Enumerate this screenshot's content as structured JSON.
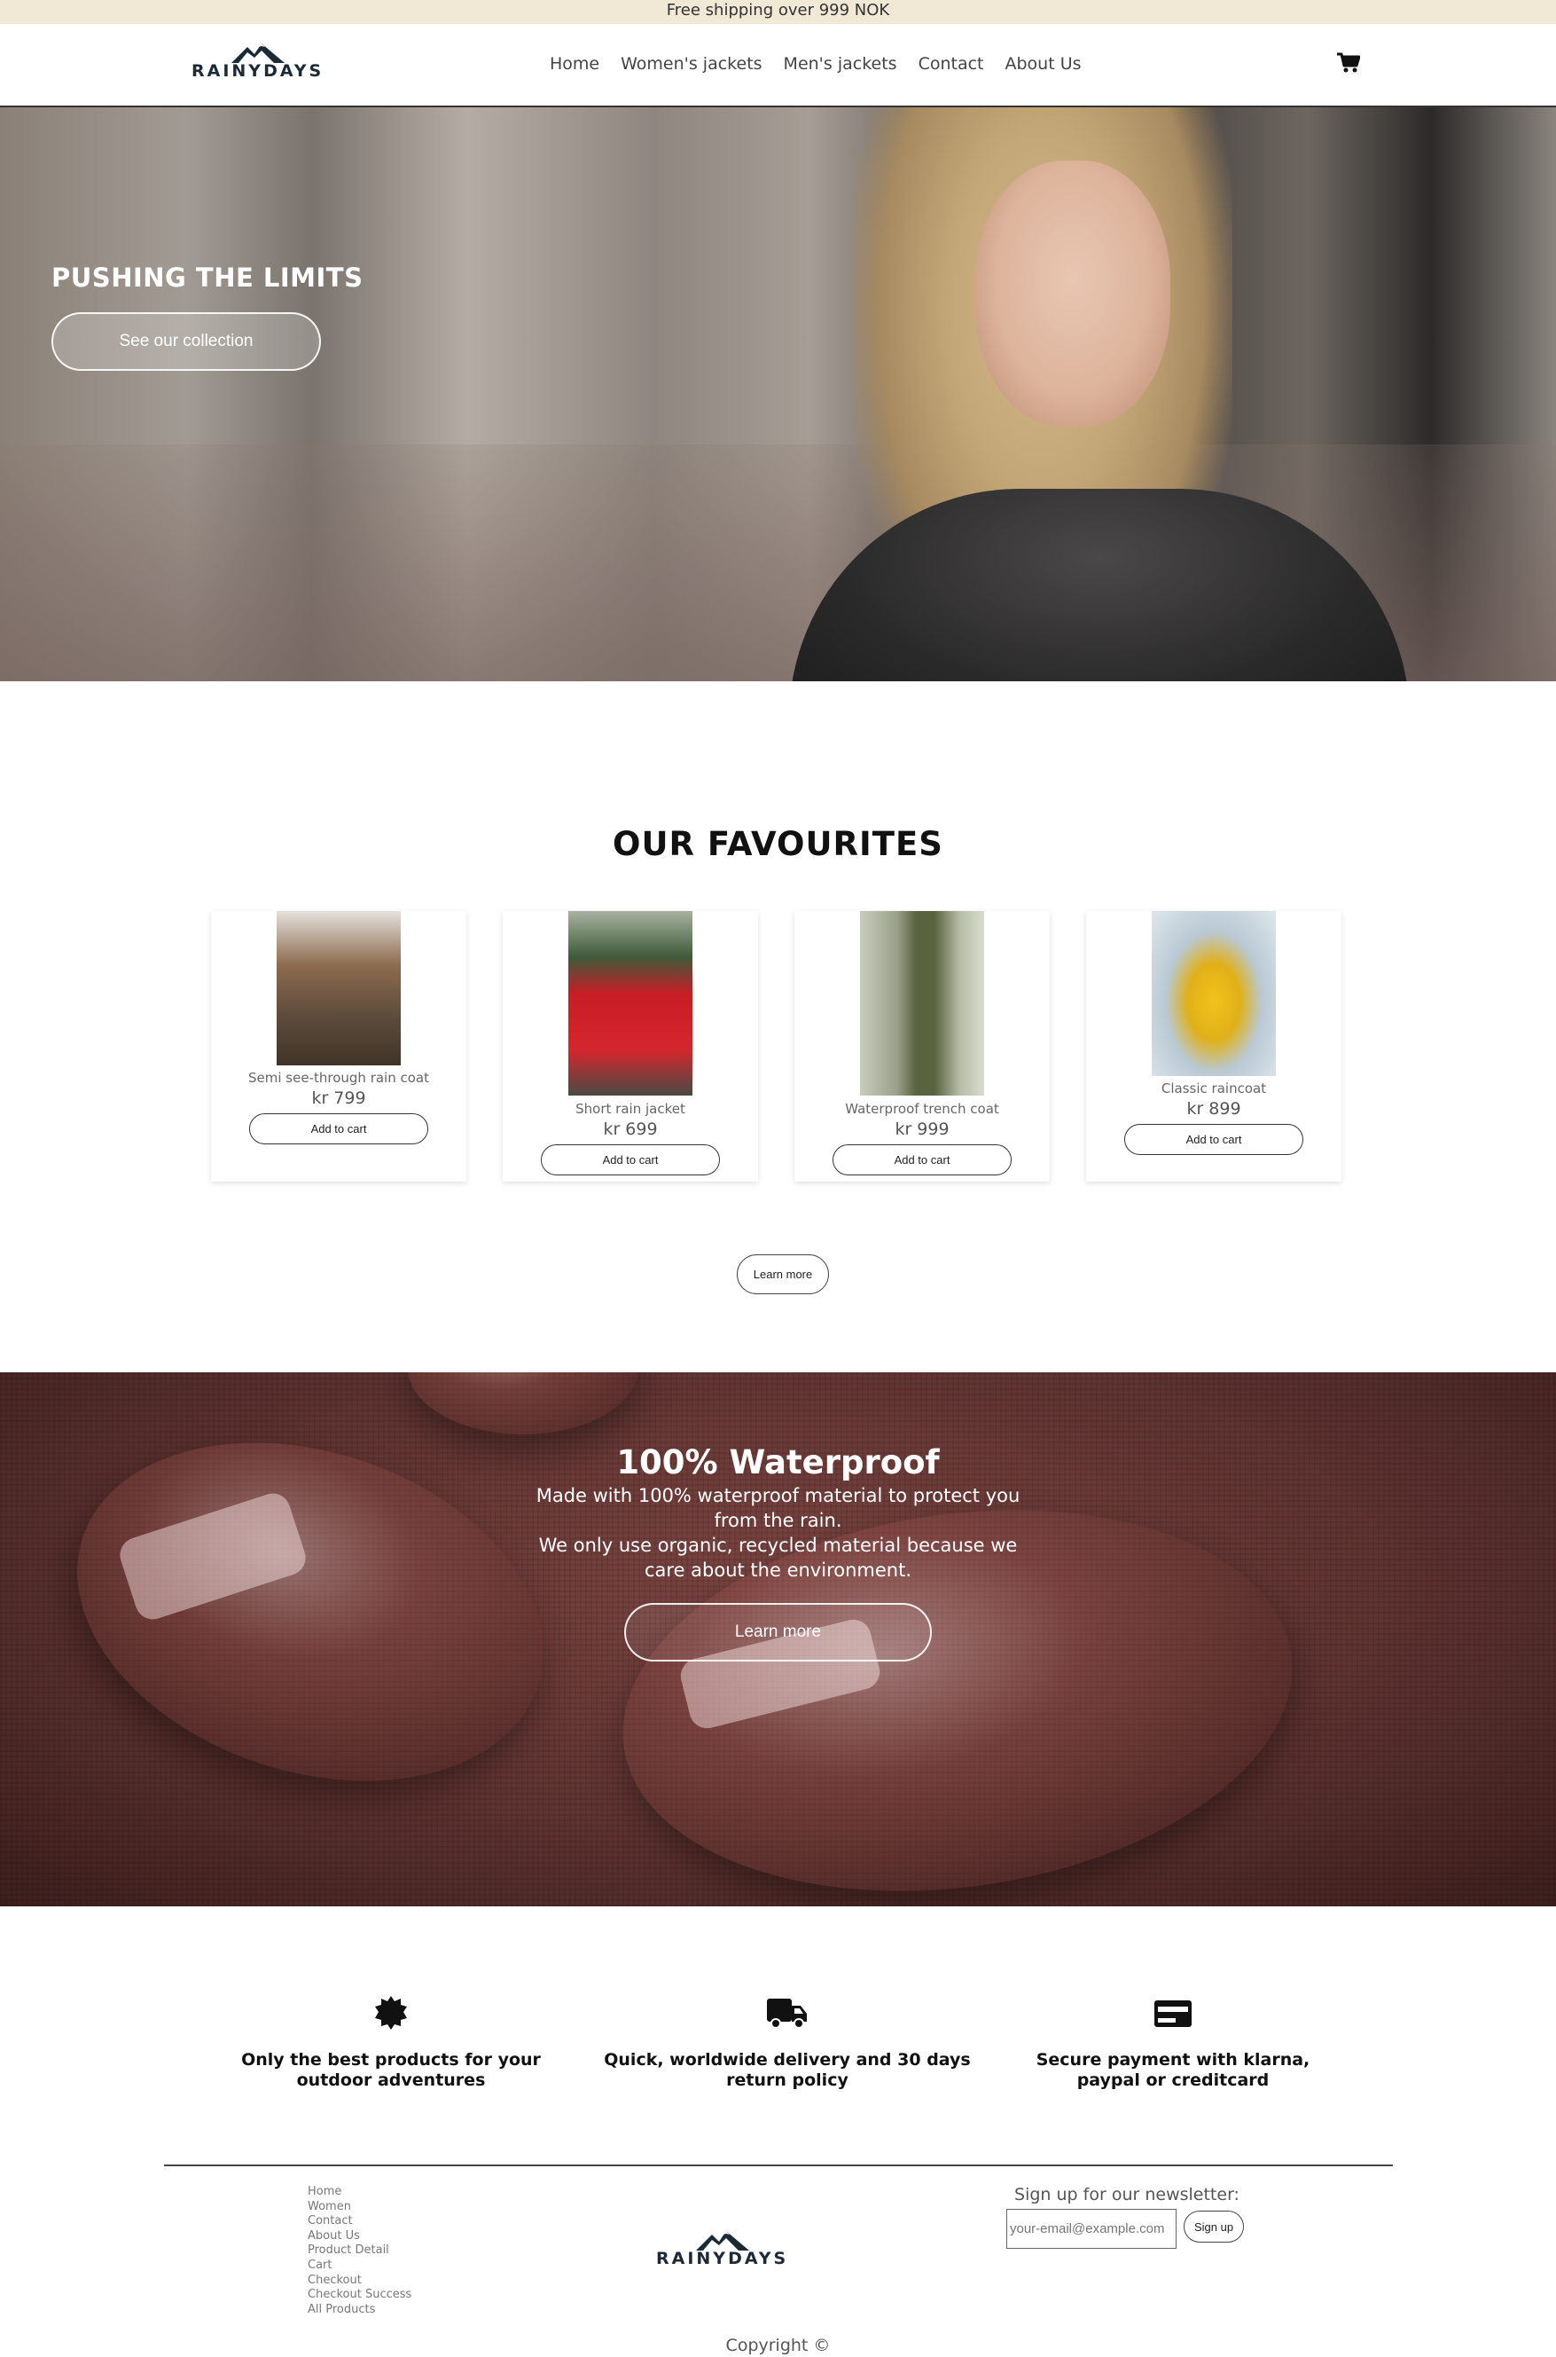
{
  "topbar": {
    "text": "Free shipping over 999 NOK"
  },
  "brand": {
    "name": "RAINYDAYS"
  },
  "nav": {
    "items": [
      {
        "label": "Home"
      },
      {
        "label": "Women's jackets"
      },
      {
        "label": "Men's jackets"
      },
      {
        "label": "Contact"
      },
      {
        "label": "About Us"
      }
    ],
    "cart_icon": "shopping-cart-icon"
  },
  "hero": {
    "title": "PUSHING THE LIMITS",
    "button": "See our collection"
  },
  "favourites": {
    "title": "OUR FAVOURITES",
    "products": [
      {
        "name": "Semi see-through rain coat",
        "price": "kr 799",
        "button": "Add to cart",
        "image_colors": [
          "#5b4a3a",
          "#8c6b4f"
        ]
      },
      {
        "name": "Short rain jacket",
        "price": "kr 699",
        "button": "Add to cart",
        "image_colors": [
          "#c81d25",
          "#3f5a3a"
        ]
      },
      {
        "name": "Waterproof trench coat",
        "price": "kr 999",
        "button": "Add to cart",
        "image_colors": [
          "#5a6340",
          "#9aa08a"
        ]
      },
      {
        "name": "Classic raincoat",
        "price": "kr 899",
        "button": "Add to cart",
        "image_colors": [
          "#f2c21b",
          "#b9c9d4"
        ]
      }
    ],
    "learn_more": "Learn more"
  },
  "waterproof": {
    "title": "100% Waterproof",
    "text1": "Made with 100% waterproof material to protect you from the rain.",
    "text2": "We only use organic, recycled material because we care about the environment.",
    "button": "Learn more"
  },
  "features": [
    {
      "icon": "badge-icon",
      "text": "Only the best products for your outdoor adventures"
    },
    {
      "icon": "truck-icon",
      "text": "Quick, worldwide delivery and 30 days return policy"
    },
    {
      "icon": "credit-card-icon",
      "text": "Secure payment with klarna, paypal or creditcard"
    }
  ],
  "footer": {
    "links": [
      "Home",
      "Women",
      "Contact",
      "About Us",
      "Product Detail",
      "Cart",
      "Checkout",
      "Checkout Success",
      "All Products"
    ],
    "newsletter_title": "Sign up for our newsletter:",
    "newsletter_placeholder": "your-email@example.com",
    "newsletter_button": "Sign up",
    "copyright": "Copyright ©"
  }
}
